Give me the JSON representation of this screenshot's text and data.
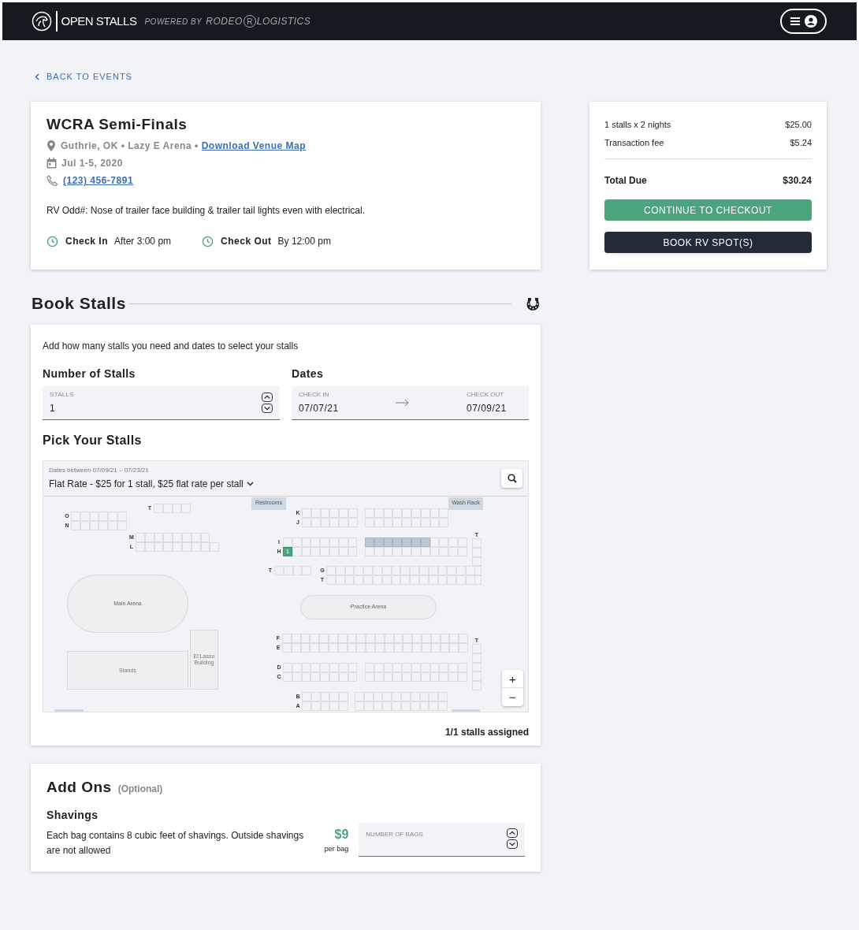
{
  "header": {
    "brand": "OPEN STALLS",
    "powered_by": "POWERED BY",
    "partner_left": "RODEO",
    "partner_mark": "R",
    "partner_right": "LOGISTICS"
  },
  "back_link": "BACK TO EVENTS",
  "event": {
    "title": "WCRA Semi-Finals",
    "location": "Guthrie, OK • Lazy E Arena •",
    "venue_map_link": "Download Venue Map",
    "dates": "Jul 1-5, 2020",
    "phone": "(123) 456-7891",
    "note": "RV Odd#: Nose of trailer face building & trailer tail lights even with electrical.",
    "check_in_label": "Check In",
    "check_in_value": "After 3:00 pm",
    "check_out_label": "Check Out",
    "check_out_value": "By 12:00 pm"
  },
  "summary": {
    "lines": [
      {
        "label": "1 stalls x 2 nights",
        "amount": "$25.00"
      },
      {
        "label": "Transaction fee",
        "amount": "$5.24"
      }
    ],
    "total_label": "Total Due",
    "total_amount": "$30.24",
    "checkout_button": "CONTINUE TO CHECKOUT",
    "rv_button": "BOOK RV SPOT(S)"
  },
  "book_stalls": {
    "title": "Book Stalls",
    "intro": "Add how many stalls you need and dates to select your stalls",
    "stalls_heading": "Number of Stalls",
    "stalls_field": {
      "label": "STALLS",
      "value": "1"
    },
    "dates_heading": "Dates",
    "check_in": {
      "label": "CHECK IN",
      "value": "07/07/21"
    },
    "check_out": {
      "label": "CHECK OUT",
      "value": "07/09/21"
    },
    "pick_heading": "Pick Your Stalls",
    "map_dates": "Dates between 07/09/21 – 07/23/21",
    "rate": "Flat Rate - $25 for 1 stall, $25 flat rate per stall",
    "zoom_in": "+",
    "zoom_out": "−",
    "assigned": "1/1 stalls assigned"
  },
  "map": {
    "facilities": [
      {
        "kind": "tag",
        "name": "Restrooms"
      },
      {
        "kind": "tag",
        "name": "Wash Rack"
      },
      {
        "kind": "oval",
        "name": "Main Arena"
      },
      {
        "kind": "rect",
        "name": "Stands"
      },
      {
        "kind": "rect",
        "name": "El Lasso Building"
      },
      {
        "kind": "oval",
        "name": "Practice Arena"
      }
    ],
    "blocks": [
      {
        "rows": [
          {
            "label": "O"
          },
          {
            "label": "N"
          }
        ]
      },
      {
        "rows": [
          {
            "label": "T"
          }
        ]
      },
      {
        "rows": [
          {
            "label": "M"
          },
          {
            "label": "L"
          }
        ]
      },
      {
        "rows": [
          {
            "label": "K"
          },
          {
            "label": "J"
          }
        ]
      },
      {
        "rows": [
          {},
          {}
        ]
      },
      {
        "rows": [
          {
            "label": "I",
            "cells": [
              {
                "selected": false,
                "unavailable": false
              },
              {
                "selected": false,
                "unavailable": false
              },
              {
                "selected": false,
                "unavailable": false
              },
              {
                "selected": false,
                "unavailable": false
              },
              {
                "selected": false,
                "unavailable": false
              },
              {
                "selected": false,
                "unavailable": false
              },
              {
                "selected": false,
                "unavailable": false
              },
              {
                "selected": false,
                "unavailable": false
              }
            ]
          },
          {
            "label": "H",
            "cells": [
              {
                "selected": true,
                "unavailable": false,
                "number": "1"
              },
              {
                "selected": false,
                "unavailable": false
              },
              {
                "selected": false,
                "unavailable": false
              },
              {
                "selected": false,
                "unavailable": false
              },
              {
                "selected": false,
                "unavailable": false
              },
              {
                "selected": false,
                "unavailable": false
              },
              {
                "selected": false,
                "unavailable": false
              },
              {
                "selected": false,
                "unavailable": false
              }
            ]
          }
        ]
      },
      {
        "rows": [
          {
            "cells": [
              {
                "selected": false,
                "unavailable": true
              },
              {
                "selected": false,
                "unavailable": true
              },
              {
                "selected": false,
                "unavailable": true
              },
              {
                "selected": false,
                "unavailable": true
              },
              {
                "selected": false,
                "unavailable": true
              },
              {
                "selected": false,
                "unavailable": true
              },
              {
                "selected": false,
                "unavailable": true
              },
              {
                "selected": false,
                "unavailable": false
              },
              {
                "selected": false,
                "unavailable": false
              },
              {
                "selected": false,
                "unavailable": false
              },
              {
                "selected": false,
                "unavailable": false
              }
            ]
          },
          {
            "cells": [
              {
                "selected": false,
                "unavailable": false
              },
              {
                "selected": false,
                "unavailable": false
              },
              {
                "selected": false,
                "unavailable": false
              },
              {
                "selected": false,
                "unavailable": false
              },
              {
                "selected": false,
                "unavailable": false
              },
              {
                "selected": false,
                "unavailable": false
              },
              {
                "selected": false,
                "unavailable": false
              },
              {
                "selected": false,
                "unavailable": false
              },
              {
                "selected": false,
                "unavailable": false
              },
              {
                "selected": false,
                "unavailable": false
              },
              {
                "selected": false,
                "unavailable": false
              }
            ]
          }
        ]
      },
      {
        "rows": [
          {
            "label": "T"
          }
        ]
      },
      {
        "rows": [
          {
            "label": "T"
          }
        ]
      },
      {
        "rows": [
          {
            "label": "G"
          },
          {
            "label": "T"
          }
        ]
      },
      {
        "rows": [
          {
            "label": "F"
          },
          {
            "label": "E"
          }
        ]
      },
      {
        "rows": [
          {
            "label": "T"
          }
        ]
      },
      {
        "rows": [
          {
            "label": "D"
          },
          {
            "label": "C"
          }
        ]
      },
      {
        "rows": [
          {},
          {}
        ]
      },
      {
        "rows": [
          {
            "label": "B"
          },
          {
            "label": "A"
          }
        ]
      },
      {
        "rows": [
          {},
          {}
        ]
      }
    ]
  },
  "add_ons": {
    "title": "Add Ons",
    "optional": "(Optional)",
    "items": [
      {
        "name": "Shavings",
        "description": "Each bag contains 8 cubic feet of shavings. Outside shavings are not allowed",
        "price": "$9",
        "unit": "per bag",
        "field_placeholder": "NUMBER OF BAGS"
      }
    ]
  }
}
